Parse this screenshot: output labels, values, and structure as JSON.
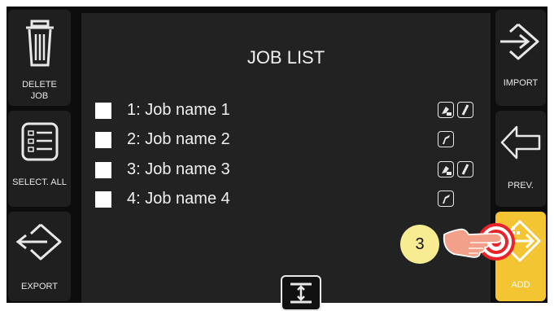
{
  "left_buttons": {
    "delete_line1": "DELETE",
    "delete_line2": "JOB",
    "select_all": "SELECT. ALL",
    "export": "EXPORT"
  },
  "right_buttons": {
    "import": "IMPORT",
    "prev": "PREV.",
    "add": "ADD"
  },
  "title": "JOB LIST",
  "jobs": [
    {
      "label": "1: Job name 1",
      "checked": false,
      "icons": [
        "dc-welding-torch-icon",
        "electrode-icon"
      ]
    },
    {
      "label": "2: Job name 2",
      "checked": false,
      "icons": [
        "tig-torch-icon"
      ]
    },
    {
      "label": "3: Job name 3",
      "checked": false,
      "icons": [
        "dc-welding-torch-icon",
        "electrode-icon"
      ]
    },
    {
      "label": "4: Job name 4",
      "checked": false,
      "icons": [
        "tig-torch-icon"
      ]
    }
  ],
  "step_badge": "3",
  "colors": {
    "active_button": "#f3c532",
    "badge": "#f7ec92",
    "target": "#e8232a"
  }
}
